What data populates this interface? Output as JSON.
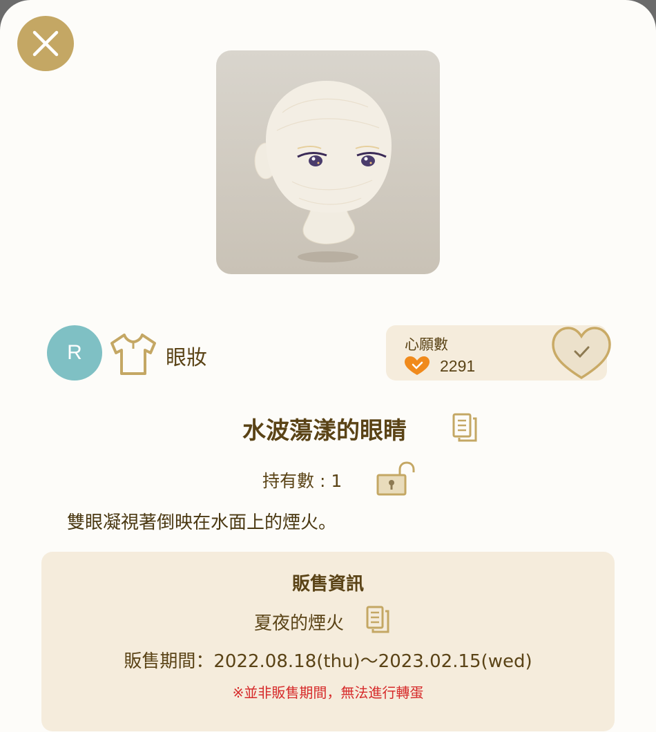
{
  "rarity": "R",
  "category": "眼妝",
  "wishlist": {
    "title": "心願數",
    "count": "2291"
  },
  "item": {
    "name": "水波蕩漾的眼睛",
    "owned_label": "持有數 : 1",
    "description": "雙眼凝視著倒映在水面上的煙火。"
  },
  "sale_info": {
    "title": "販售資訊",
    "event_name": "夏夜的煙火",
    "period": "販售期間：2022.08.18(thu)～2023.02.15(wed)",
    "note": "※並非販售期間，無法進行轉蛋"
  },
  "colors": {
    "gold": "#c4a764",
    "brown_text": "#5a4316",
    "rarity_teal": "#7fc0c4",
    "panel_bg": "#f5ecdc",
    "warning_red": "#d62a2a",
    "heart_orange": "#f08a1c"
  },
  "icons": {
    "close": "close-icon",
    "category": "shirt-icon",
    "wish": "heart-check-icon",
    "copy": "copy-icon",
    "lock": "unlocked-padlock-icon"
  }
}
